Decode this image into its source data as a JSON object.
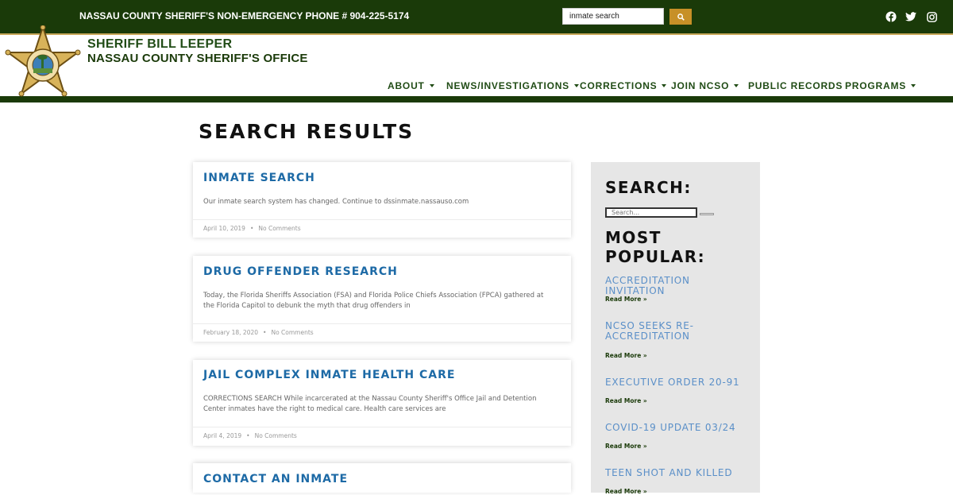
{
  "topbar": {
    "phone": "NASSAU COUNTY SHERIFF'S NON-EMERGENCY PHONE # 904-225-5174",
    "search_value": "inmate search"
  },
  "header": {
    "line1": "SHERIFF BILL LEEPER",
    "line2": "NASSAU COUNTY SHERIFF'S OFFICE"
  },
  "nav": {
    "items": [
      {
        "label": "ABOUT"
      },
      {
        "label": "NEWS/INVESTIGATIONS"
      },
      {
        "label": "CORRECTIONS"
      },
      {
        "label": "JOIN NCSO"
      },
      {
        "label": "PUBLIC RECORDS"
      },
      {
        "label": "PROGRAMS"
      }
    ]
  },
  "page": {
    "title": "SEARCH RESULTS"
  },
  "results": [
    {
      "title": "INMATE SEARCH",
      "excerpt": "Our inmate search system has changed. Continue to dssinmate.nassauso.com",
      "date": "April 10, 2019",
      "comments": "No Comments"
    },
    {
      "title": "DRUG OFFENDER RESEARCH",
      "excerpt": "Today, the Florida Sheriffs Association (FSA) and Florida Police Chiefs Association (FPCA) gathered at the Florida Capitol to debunk the myth that drug offenders in",
      "date": "February 18, 2020",
      "comments": "No Comments"
    },
    {
      "title": "JAIL COMPLEX INMATE HEALTH CARE",
      "excerpt": "CORRECTIONS SEARCH While incarcerated at the Nassau County Sheriff's Office Jail and Detention Center inmates have the right to medical care. Health care services are",
      "date": "April 4, 2019",
      "comments": "No Comments"
    },
    {
      "title": "CONTACT AN INMATE"
    }
  ],
  "sidebar": {
    "search_heading": "SEARCH:",
    "search_placeholder": "Search...",
    "popular_heading": "MOST POPULAR:",
    "read_more": "Read More »",
    "popular": [
      {
        "title": "ACCREDITATION INVITATION"
      },
      {
        "title": "NCSO SEEKS RE-ACCREDITATION"
      },
      {
        "title": "EXECUTIVE ORDER 20-91"
      },
      {
        "title": "COVID-19 UPDATE 03/24"
      },
      {
        "title": "TEEN SHOT AND KILLED"
      }
    ]
  },
  "colors": {
    "dark_green": "#1a3a09",
    "nav_green": "#214c16",
    "gold": "#c79027",
    "link_blue": "#1d6aa6",
    "popular_blue": "#5a8fc8"
  },
  "icons": [
    "search-icon",
    "facebook-icon",
    "twitter-icon",
    "instagram-icon",
    "caret-down-icon",
    "sheriff-star-badge"
  ]
}
